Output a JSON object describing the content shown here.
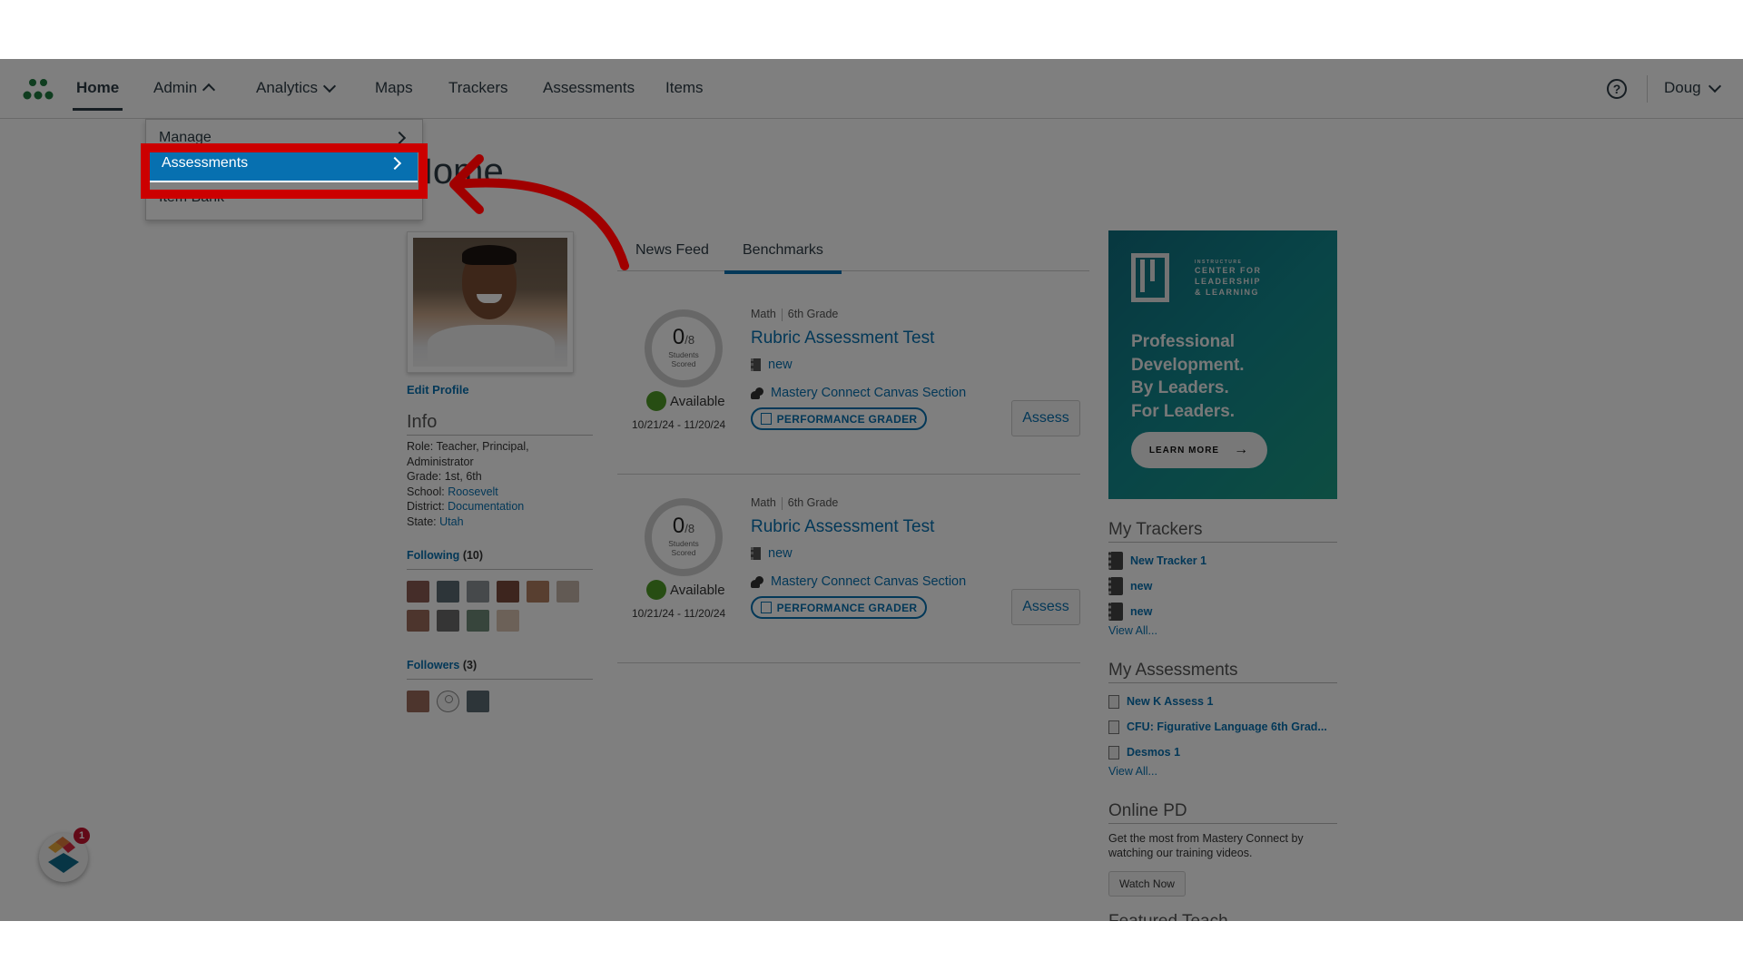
{
  "nav": {
    "items": [
      {
        "label": "Home",
        "active": true
      },
      {
        "label": "Admin",
        "chevron": "up"
      },
      {
        "label": "Analytics",
        "chevron": "down"
      },
      {
        "label": "Maps"
      },
      {
        "label": "Trackers"
      },
      {
        "label": "Assessments"
      },
      {
        "label": "Items"
      }
    ],
    "help_icon": "?",
    "user": "Doug",
    "logo_color": "#1f7a3e"
  },
  "admin_menu": {
    "items": [
      {
        "label": "Manage",
        "has_submenu": true
      },
      {
        "label": "Assessments",
        "has_submenu": true,
        "selected": true
      },
      {
        "label": "Item Bank",
        "has_submenu": false
      }
    ],
    "highlight_color": "#cc0000",
    "selected_color": "#0770b0"
  },
  "page": {
    "title": "Home",
    "dim_overlay": true
  },
  "profile": {
    "edit_label": "Edit Profile",
    "info_heading": "Info",
    "role_label": "Role:",
    "role_value": "Teacher, Principal, Administrator",
    "grade_label": "Grade:",
    "grade_value": "1st, 6th",
    "school_label": "School:",
    "school_value": "Roosevelt",
    "district_label": "District:",
    "district_value": "Documentation",
    "state_label": "State:",
    "state_value": "Utah",
    "following_label": "Following",
    "following_count": "(10)",
    "followers_label": "Followers",
    "followers_count": "(3)"
  },
  "tabs": [
    {
      "label": "News Feed",
      "active": false
    },
    {
      "label": "Benchmarks",
      "active": true
    }
  ],
  "benchmarks": [
    {
      "scored": "0",
      "total": "/8",
      "scored_label_1": "Students",
      "scored_label_2": "Scored",
      "status": "Available",
      "dates": "10/21/24 - 11/20/24",
      "subject": "Math",
      "grade": "6th Grade",
      "title": "Rubric Assessment Test",
      "tracker": "new",
      "section": "Mastery Connect Canvas Section",
      "grader_label": "PERFORMANCE GRADER",
      "assess_label": "Assess"
    },
    {
      "scored": "0",
      "total": "/8",
      "scored_label_1": "Students",
      "scored_label_2": "Scored",
      "status": "Available",
      "dates": "10/21/24 - 11/20/24",
      "subject": "Math",
      "grade": "6th Grade",
      "title": "Rubric Assessment Test",
      "tracker": "new",
      "section": "Mastery Connect Canvas Section",
      "grader_label": "PERFORMANCE GRADER",
      "assess_label": "Assess"
    }
  ],
  "ad": {
    "brand_small": "INSTRUCTURE",
    "brand_line1": "CENTER FOR",
    "brand_line2": "LEADERSHIP",
    "brand_line3": "& LEARNING",
    "head_1": "Professional",
    "head_2": "Development.",
    "head_3": "By Leaders.",
    "head_4": "For Leaders.",
    "button": "LEARN MORE",
    "button_arrow": "→"
  },
  "my_trackers": {
    "heading": "My Trackers",
    "items": [
      "New Tracker 1",
      "new",
      "new"
    ],
    "view_all": "View All..."
  },
  "my_assessments": {
    "heading": "My Assessments",
    "items": [
      "New K Assess 1",
      "CFU: Figurative Language 6th Grad...",
      "Desmos 1"
    ],
    "view_all": "View All..."
  },
  "online_pd": {
    "heading": "Online PD",
    "text": "Get the most from Mastery Connect by watching our training videos.",
    "button": "Watch Now"
  },
  "featured": {
    "heading": "Featured Teach"
  },
  "widget": {
    "badge_count": "1"
  }
}
